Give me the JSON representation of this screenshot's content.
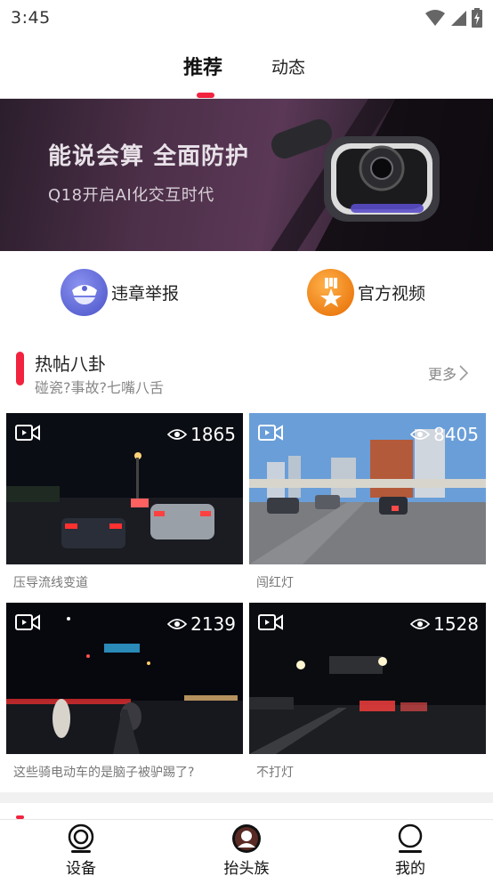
{
  "status_bar": {
    "time": "3:45"
  },
  "top_tabs": [
    {
      "label": "推荐",
      "active": true
    },
    {
      "label": "动态",
      "active": false
    }
  ],
  "banner": {
    "title": "能说会算 全面防护",
    "subtitle": "Q18开启AI化交互时代"
  },
  "quick_actions": [
    {
      "label": "违章举报",
      "icon": "police-cap-icon",
      "color": "#5b63d6"
    },
    {
      "label": "官方视频",
      "icon": "medal-star-icon",
      "color": "#f07a10"
    }
  ],
  "section": {
    "title": "热帖八卦",
    "subtitle": "碰瓷?事故?七嘴八舌",
    "more_label": "更多"
  },
  "videos": [
    {
      "views": "1865",
      "caption": "压导流线变道"
    },
    {
      "views": "8405",
      "caption": "闯红灯"
    },
    {
      "views": "2139",
      "caption": "这些骑电动车的是脑子被驴踢了?"
    },
    {
      "views": "1528",
      "caption": "不打灯"
    }
  ],
  "bottom_nav": [
    {
      "label": "设备",
      "icon": "device-icon"
    },
    {
      "label": "抬头族",
      "icon": "head-up-icon"
    },
    {
      "label": "我的",
      "icon": "profile-icon"
    }
  ],
  "colors": {
    "accent": "#f2233f"
  }
}
